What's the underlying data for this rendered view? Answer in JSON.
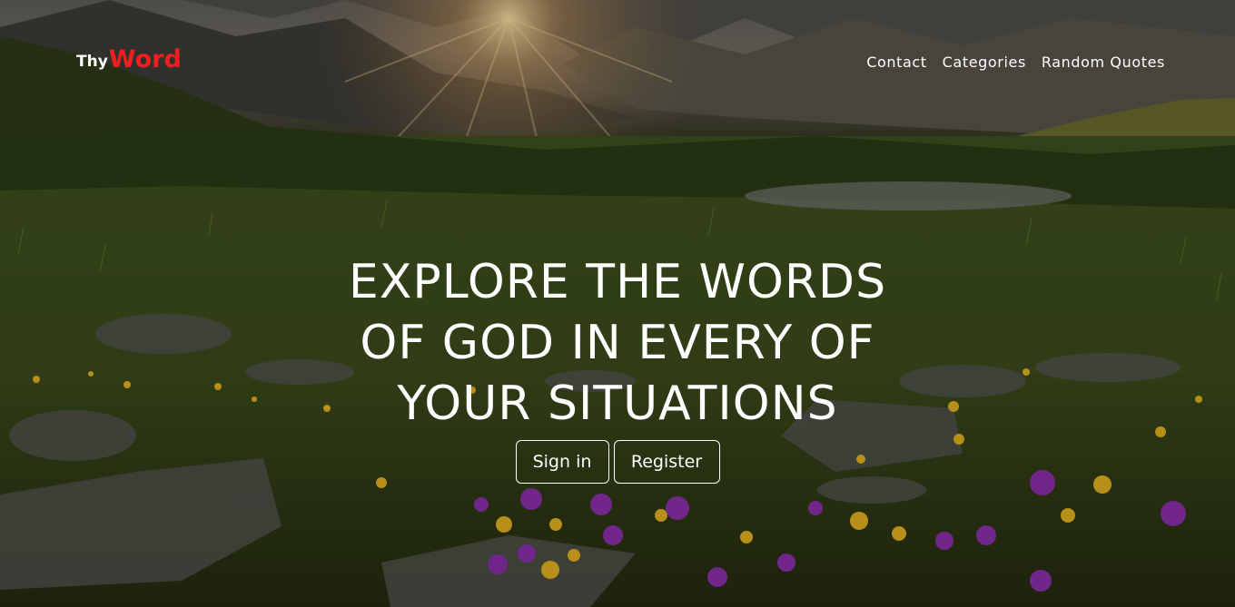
{
  "brand": {
    "prefix": "Thy",
    "name": "Word",
    "accent_color": "#f01f1f"
  },
  "nav": {
    "items": [
      {
        "label": "Contact"
      },
      {
        "label": "Categories"
      },
      {
        "label": "Random Quotes"
      }
    ]
  },
  "hero": {
    "headline_lines": [
      "EXPLORE THE WORDS",
      "OF GOD IN EVERY OF",
      "YOUR SITUATIONS"
    ],
    "signin_label": "Sign in",
    "register_label": "Register",
    "background_scene": "mountain-meadow-sunrise"
  }
}
